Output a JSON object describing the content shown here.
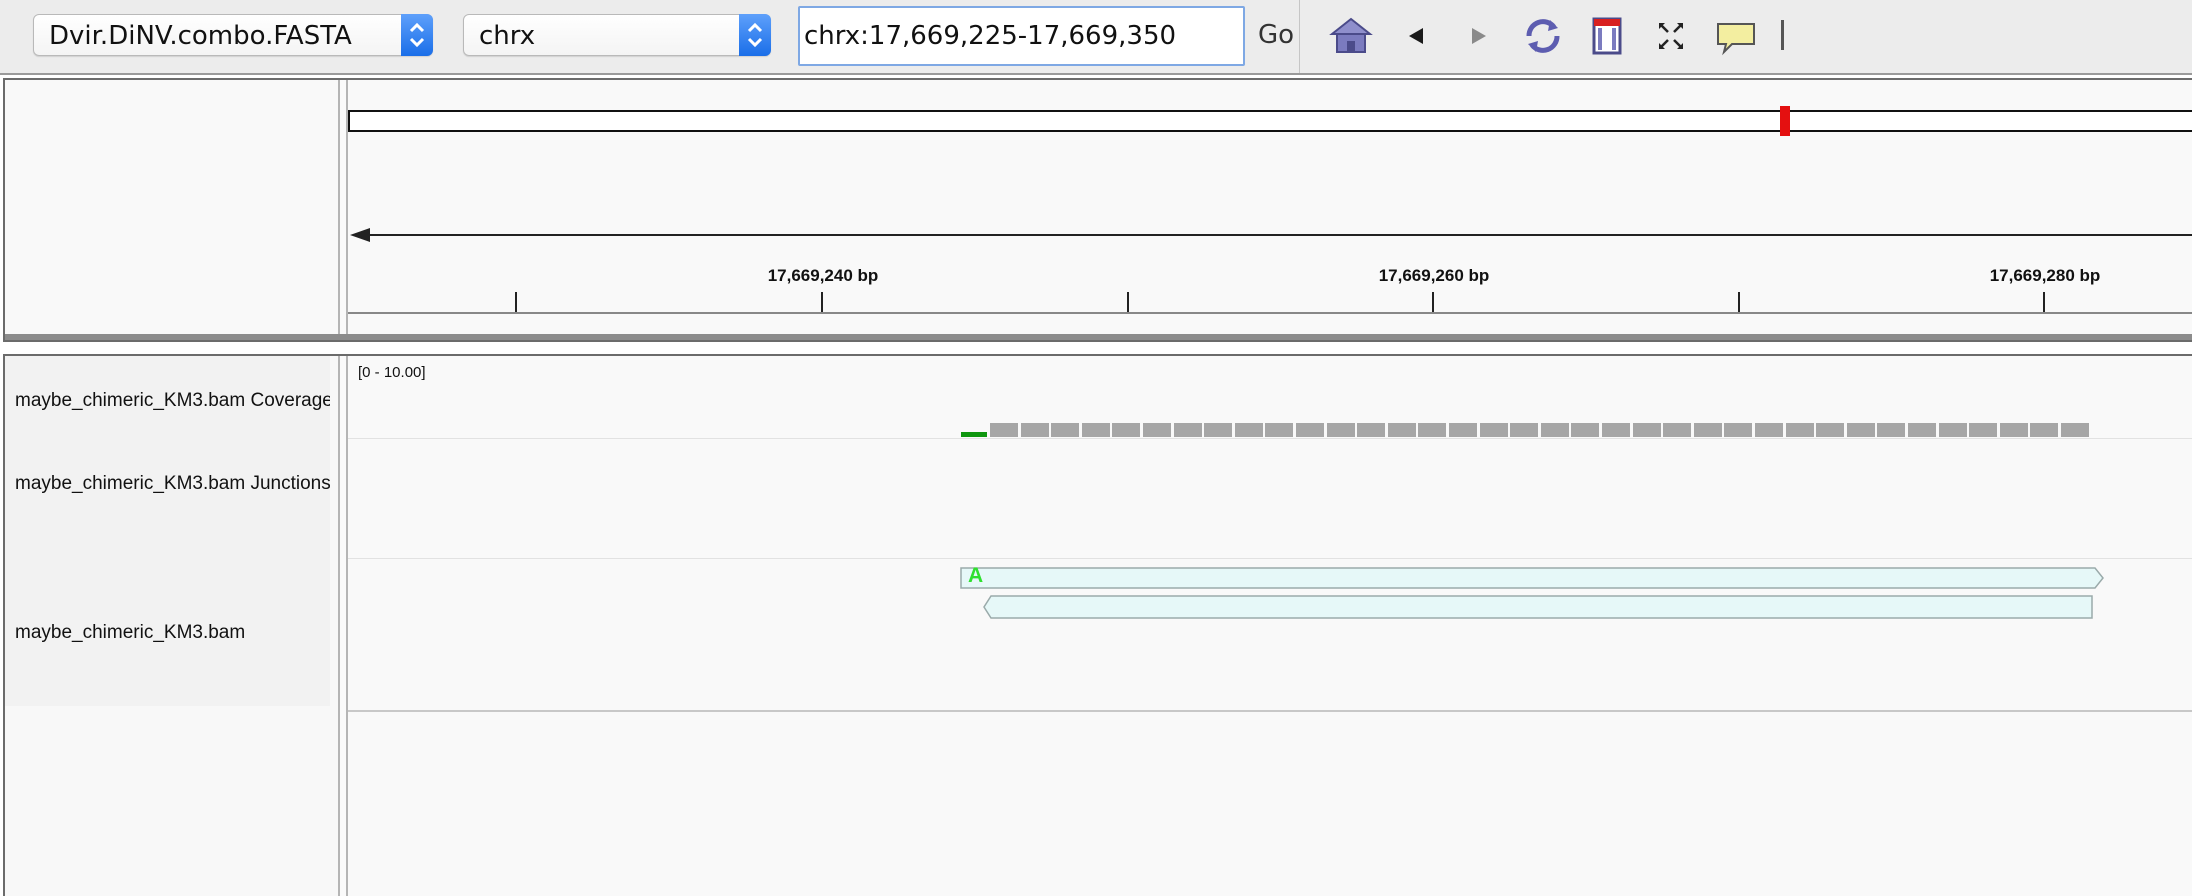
{
  "toolbar": {
    "genome_value": "Dvir.DiNV.combo.FASTA",
    "chromosome_value": "chrx",
    "locus_value": "chrx:17,669,225-17,669,350",
    "go_label": "Go",
    "icons": [
      "home-icon",
      "back-arrow-icon",
      "forward-arrow-icon",
      "refresh-icon",
      "roi-icon",
      "resize-to-window-icon",
      "popup-info-icon"
    ],
    "colors": {
      "combo_arrow": "#1a6ee8",
      "icon_blue": "#6f6fb6"
    }
  },
  "ruler": {
    "locus_start": 17669225,
    "locus_end": 17669350,
    "tick_labels": [
      "17,669,240 bp",
      "17,669,260 bp",
      "17,669,280 bp"
    ],
    "ideogram_marker_color": "#e41010"
  },
  "tracks": [
    {
      "name": "maybe_chimeric_KM3.bam Coverage",
      "type": "coverage"
    },
    {
      "name": "maybe_chimeric_KM3.bam Junctions",
      "type": "junctions"
    },
    {
      "name": "maybe_chimeric_KM3.bam",
      "type": "alignment"
    }
  ],
  "coverage": {
    "data_range": "[0 - 10.00]",
    "colors": {
      "bar": "#a6a6a6",
      "mismatch": "#0e960e"
    }
  },
  "alignments": {
    "reads": [
      {
        "strand": "+",
        "fill": "#e6f8f8"
      },
      {
        "strand": "-",
        "fill": "#e6f8f8"
      }
    ],
    "mismatch_base": "A",
    "mismatch_color": "#2fe02f"
  }
}
